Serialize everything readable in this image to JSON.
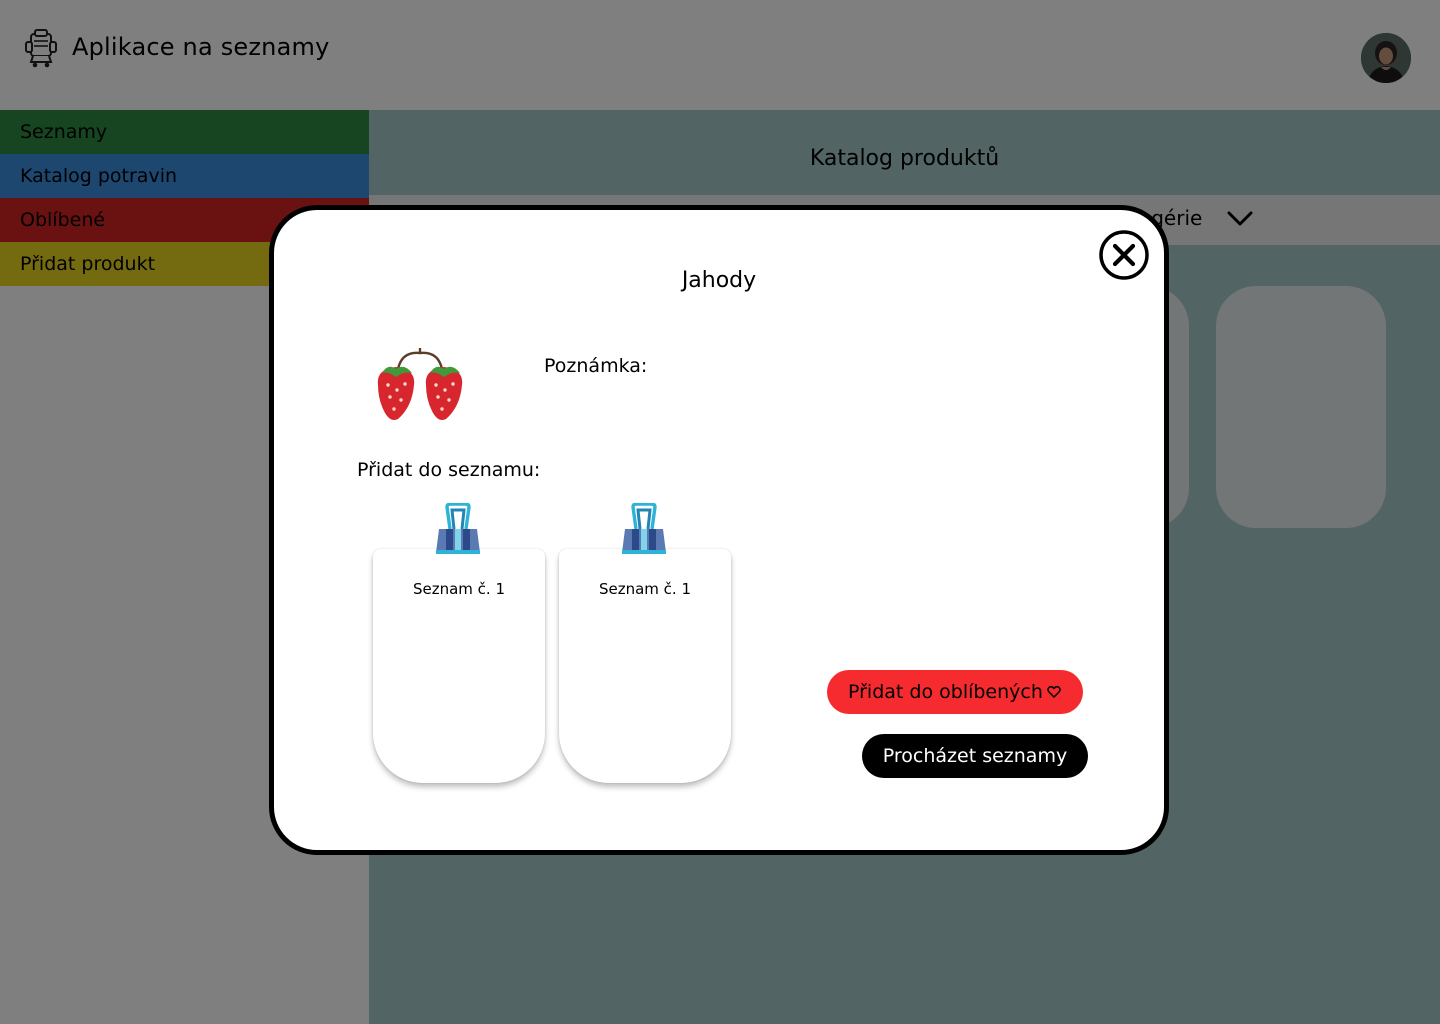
{
  "header": {
    "app_title": "Aplikace na seznamy",
    "logo_icon": "shopping-cart-robot-icon",
    "avatar": "user-avatar"
  },
  "sidebar": {
    "items": [
      {
        "label": "Seznamy",
        "color": "#2e8b44"
      },
      {
        "label": "Katalog potravin",
        "color": "#3d8ee0"
      },
      {
        "label": "Oblíbené",
        "color": "#d42424"
      },
      {
        "label": "Přidat produkt",
        "color": "#e8d41e"
      }
    ]
  },
  "main": {
    "title": "Katalog produktů",
    "category_filter": {
      "visible_text": "ogérie",
      "icon": "chevron-down-icon"
    },
    "background_color": "#a5c8c6"
  },
  "modal": {
    "title": "Jahody",
    "product_icon": "strawberries-icon",
    "note_label": "Poznámka:",
    "add_to_list_label": "Přidat do seznamu:",
    "lists": [
      {
        "name": "Seznam č. 1",
        "icon": "binder-clip-icon"
      },
      {
        "name": "Seznam č. 1",
        "icon": "binder-clip-icon"
      }
    ],
    "favorite_button": {
      "label": "Přidat do oblíbených",
      "icon": "heart-icon",
      "color": "#f62b2f"
    },
    "browse_button": {
      "label": "Procházet seznamy",
      "color": "#000000"
    },
    "close_icon": "close-circle-icon"
  }
}
